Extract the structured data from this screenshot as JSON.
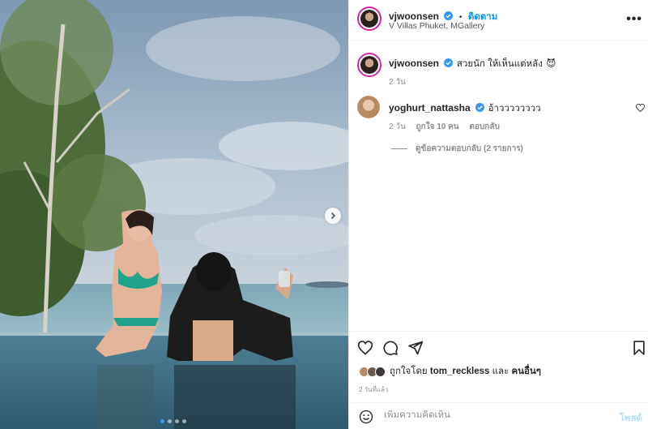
{
  "post": {
    "author": "vjwoonsen",
    "follow_label": "ติดตาม",
    "separator": "•",
    "location": "V Villas Phuket, MGallery",
    "more_label": "•••"
  },
  "caption": {
    "username": "vjwoonsen",
    "text": "สวยนัก ให้เห็นแต่หลัง",
    "emoji": "😈",
    "time": "2 วัน"
  },
  "comments": [
    {
      "username": "yoghurt_nattasha",
      "text": "อ้าวววววววว",
      "time": "2 วัน",
      "likes": "ถูกใจ 10 คน",
      "reply_label": "ตอบกลับ",
      "view_replies": "ดูข้อความตอบกลับ (2 รายการ)"
    }
  ],
  "likes": {
    "prefix": "ถูกใจโดย",
    "user": "tom_reckless",
    "and": "และ",
    "others": "คนอื่นๆ"
  },
  "posted_ago": "2 วันที่แล้ว",
  "comment_box": {
    "placeholder": "เพิ่มความคิดเห็น",
    "post_label": "โพสต์"
  },
  "carousel": {
    "total": 4,
    "current": 1
  },
  "colors": {
    "accent": "#0095f6",
    "verified": "#3897f0",
    "ring": "#d6249f"
  },
  "icons": [
    "heart-icon",
    "comment-icon",
    "share-icon",
    "bookmark-icon",
    "emoji-icon",
    "verified-icon",
    "chevron-right-icon"
  ]
}
